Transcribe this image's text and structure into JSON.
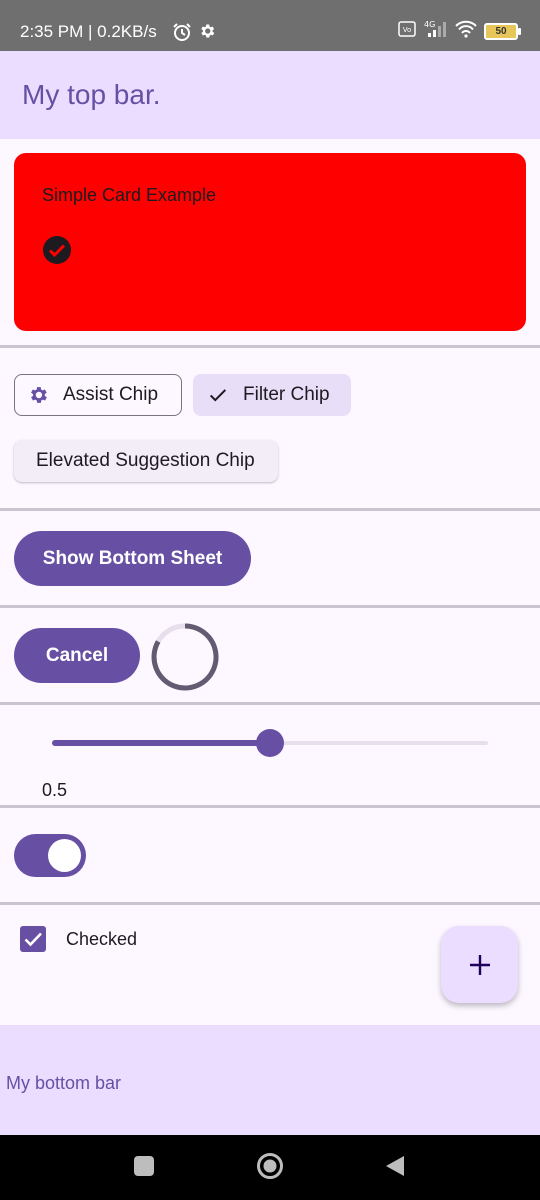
{
  "status_bar": {
    "time": "2:35 PM | 0.2KB/s",
    "icons": [
      "alarm-icon",
      "gear-icon",
      "volte-icon",
      "signal-4g-icon",
      "wifi-icon"
    ],
    "battery": "50"
  },
  "top_bar": {
    "title": "My top bar."
  },
  "card": {
    "text": "Simple Card Example",
    "background": "#ff0000",
    "icon": "check-circle-icon"
  },
  "chips": {
    "assist_label": "Assist Chip",
    "filter_label": "Filter Chip",
    "elevated_label": "Elevated Suggestion Chip"
  },
  "buttons": {
    "show_bottom_sheet": "Show Bottom Sheet",
    "cancel": "Cancel"
  },
  "slider": {
    "value": 0.5,
    "value_label": "0.5"
  },
  "switch": {
    "checked": true
  },
  "checkbox": {
    "checked": true,
    "label": "Checked"
  },
  "fab": {
    "icon": "plus-icon"
  },
  "bottom_bar": {
    "text": "My bottom bar"
  },
  "colors": {
    "primary": "#6750a4",
    "primary_container": "#eaddff",
    "card_red": "#ff0000",
    "divider": "#cac4d0"
  }
}
